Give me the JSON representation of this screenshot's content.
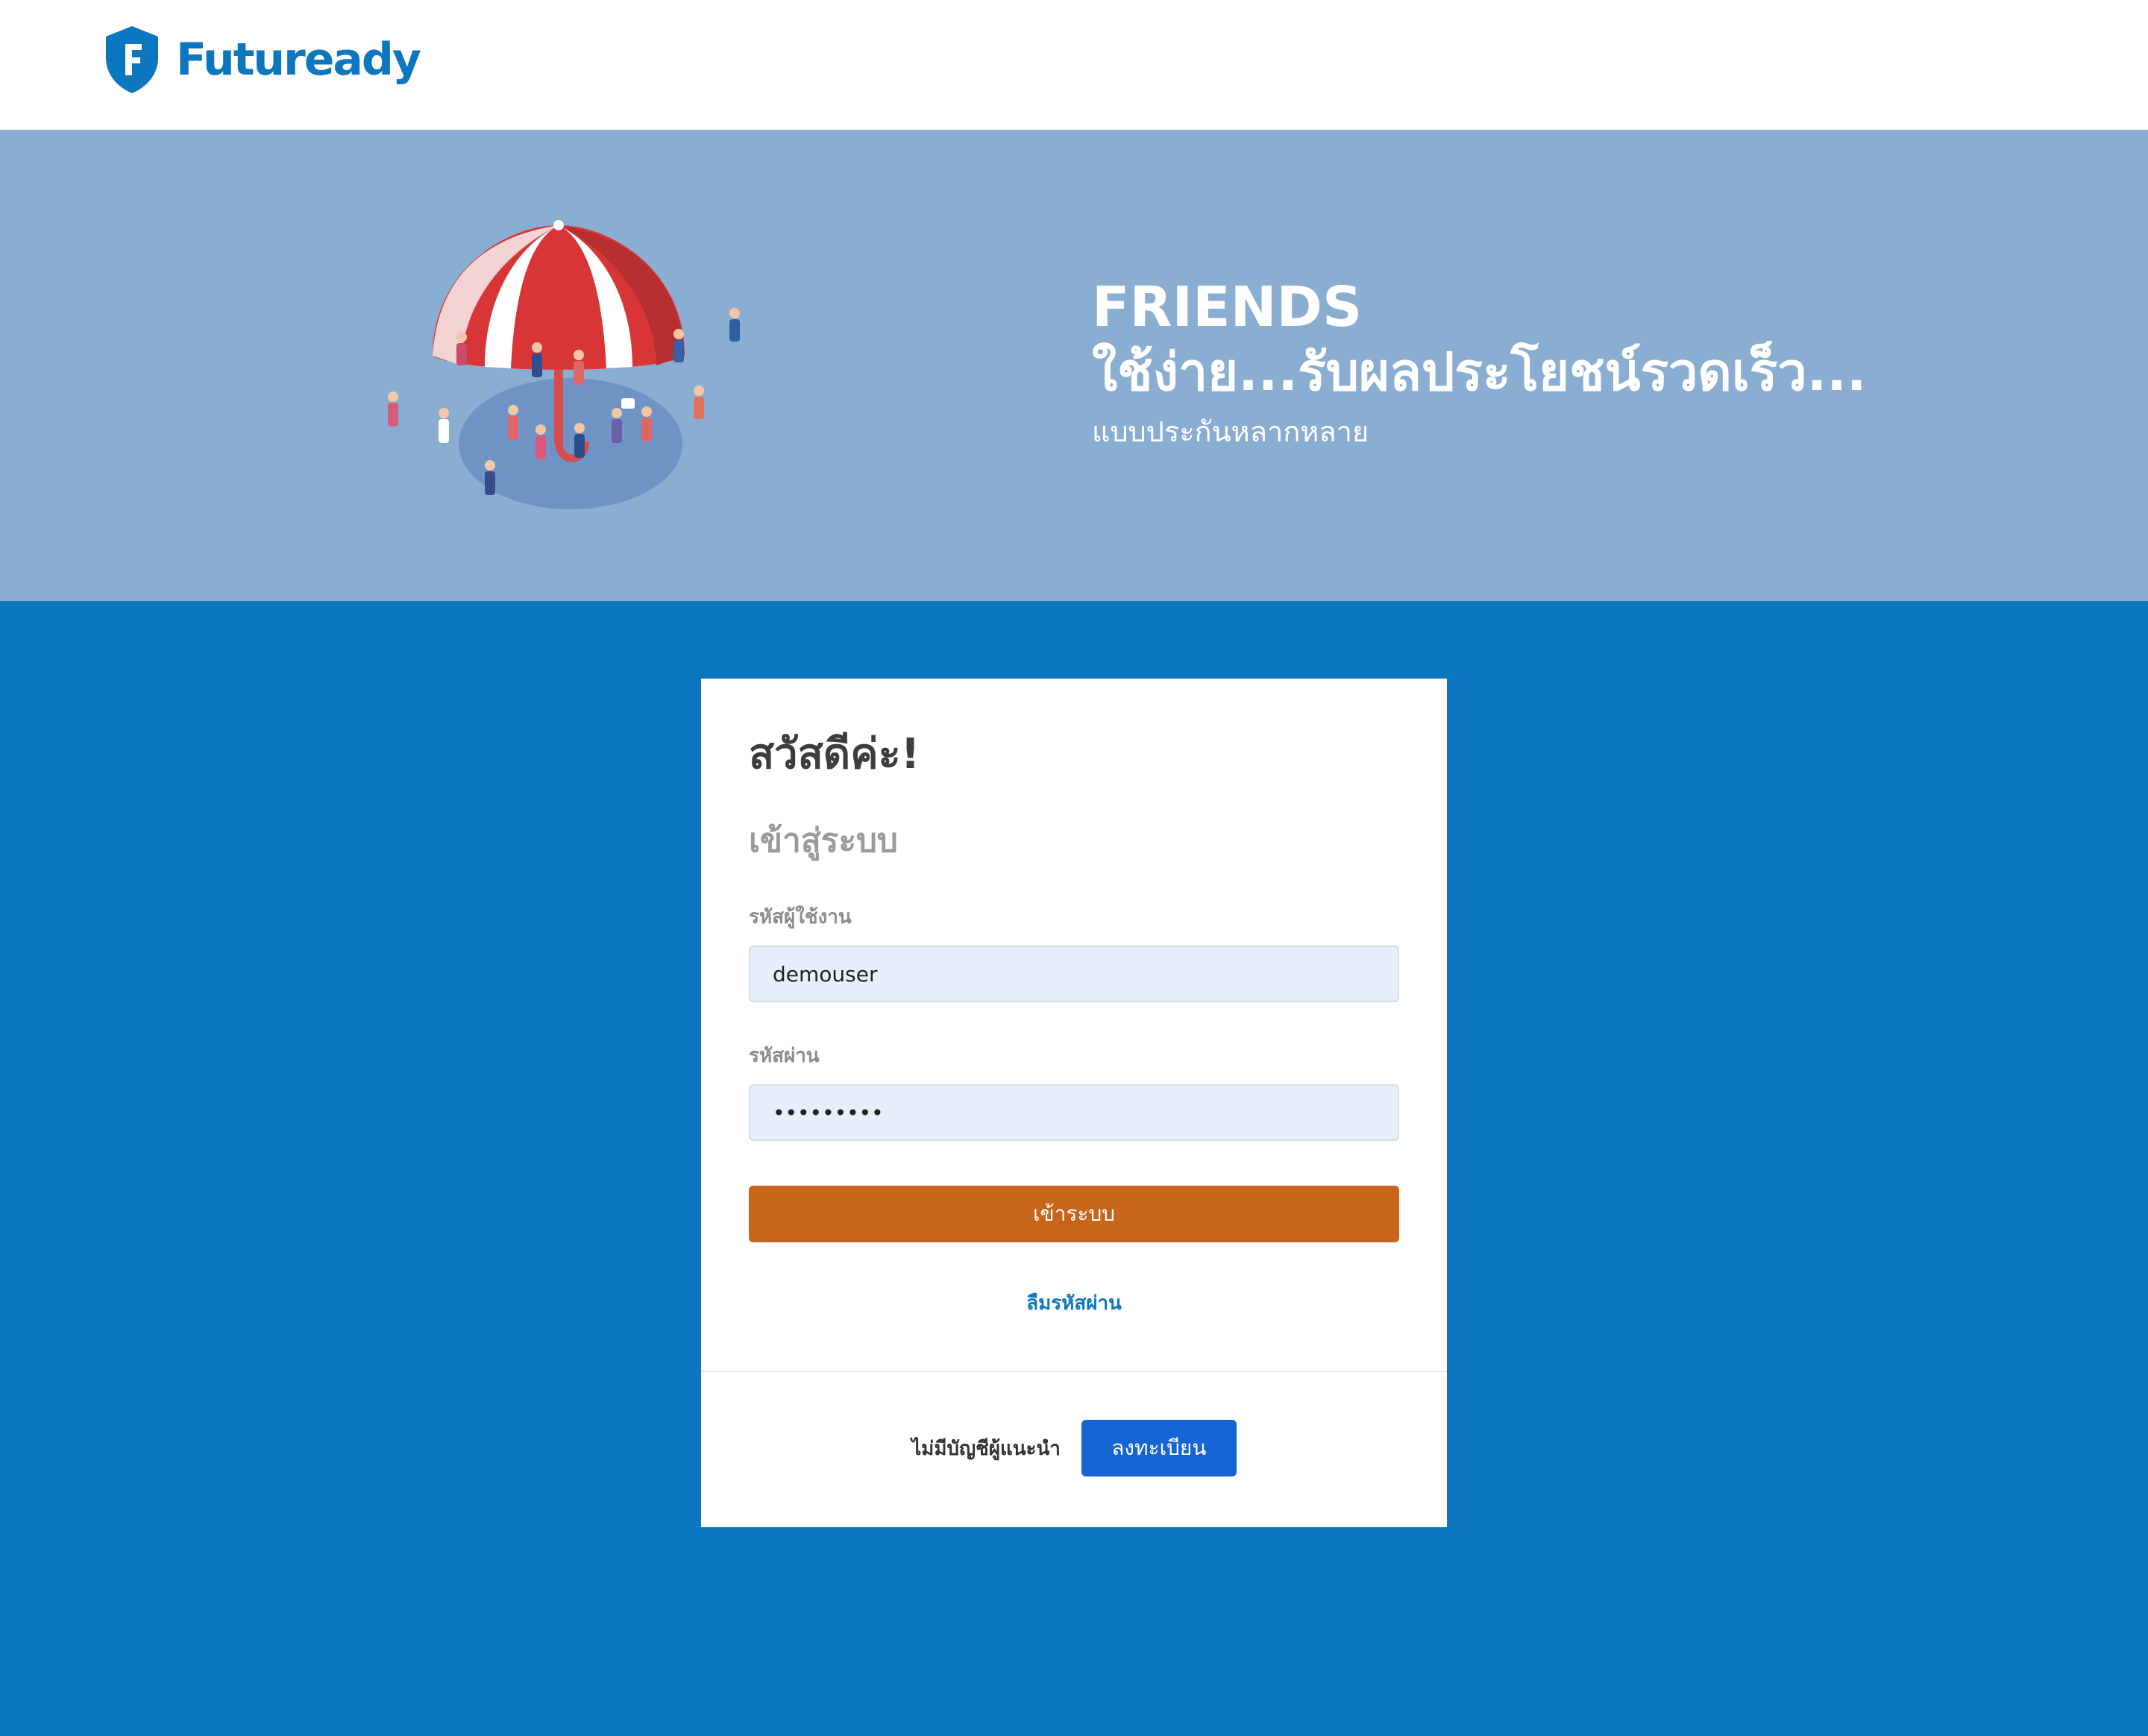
{
  "header": {
    "brand_name": "Futuready",
    "logo_letter": "F"
  },
  "banner": {
    "title": "FRIENDS",
    "subtitle": "ใช้ง่าย...รับผลประโยชน์รวดเร็ว...",
    "caption": "แบบประกันหลากหลาย",
    "illustration": "umbrella-with-people-illustration"
  },
  "login": {
    "greeting": "สวัสดีค่ะ!",
    "heading": "เข้าสู่ระบบ",
    "username_label": "รหัสผู้ใช้งาน",
    "username_value": "demouser",
    "password_label": "รหัสผ่าน",
    "password_value": "123456789",
    "submit_label": "เข้าระบบ",
    "forgot_label": "ลืมรหัสผ่าน",
    "no_account_text": "ไม่มีบัญชีผู้แนะนำ",
    "register_label": "ลงทะเบียน"
  },
  "colors": {
    "brand_blue": "#0c76bf",
    "banner_bg": "#8aadd2",
    "login_button": "#c9651a",
    "register_button": "#1464d6",
    "input_bg": "#e6f0fb"
  }
}
